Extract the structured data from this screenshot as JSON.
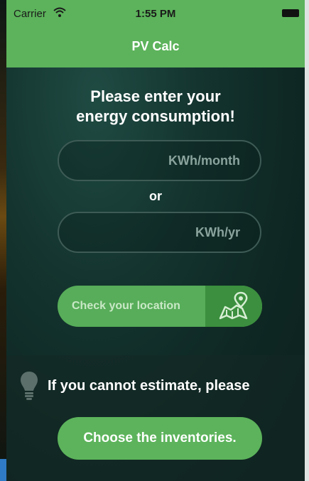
{
  "status_bar": {
    "carrier": "Carrier",
    "time": "1:55 PM"
  },
  "header": {
    "title": "PV Calc",
    "color": "#5cb35b"
  },
  "form": {
    "prompt_line1": "Please enter your",
    "prompt_line2": "energy consumption!",
    "monthly_unit": "KWh/month",
    "separator": "or",
    "yearly_unit": "KWh/yr"
  },
  "location": {
    "label": "Check your location",
    "icon": "map-pin-icon"
  },
  "tip": {
    "icon": "lightbulb-icon",
    "text": "If you cannot estimate, please"
  },
  "actions": {
    "choose_label": "Choose the inventories."
  },
  "colors": {
    "accent": "#5cb35b",
    "accent_dark": "#3b8f3e",
    "background": "#14342f"
  }
}
